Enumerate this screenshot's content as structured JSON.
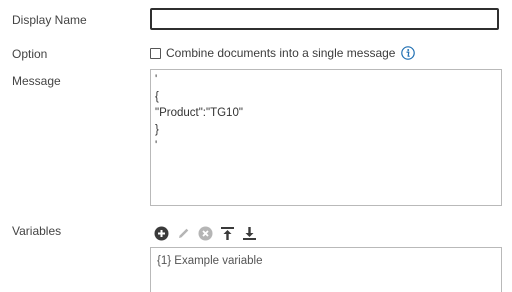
{
  "labels": {
    "display_name": "Display Name",
    "option": "Option",
    "message": "Message",
    "variables": "Variables"
  },
  "display_name": {
    "value": "",
    "placeholder": ""
  },
  "option": {
    "checkbox_label": "Combine documents into a single message",
    "checked": false,
    "info_icon": "info-icon"
  },
  "message": {
    "value": "'\n{\n\"Product\":\"TG10\"\n}\n'"
  },
  "variables": {
    "toolbar_icons": [
      "add-icon",
      "edit-icon",
      "remove-icon",
      "move-up-icon",
      "move-down-icon"
    ],
    "items": [
      {
        "label": "{1} Example variable"
      }
    ]
  },
  "colors": {
    "info_accent": "#1f6fb2",
    "icon_dark": "#3a3a3a",
    "icon_disabled": "#b5b5b5"
  }
}
